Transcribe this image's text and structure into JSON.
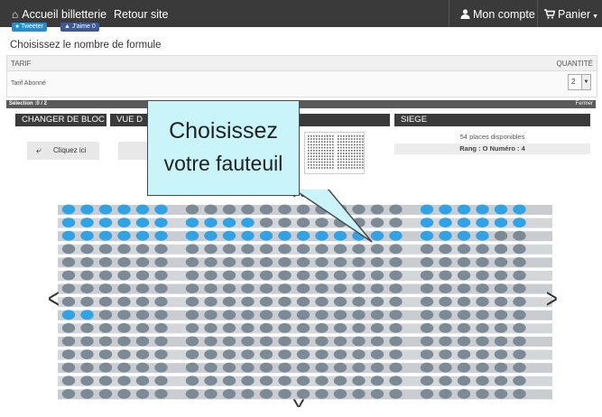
{
  "nav": {
    "home": "Accueil billetterie",
    "back_site": "Retour site",
    "account": "Mon compte",
    "cart": "Panier"
  },
  "social": {
    "tweet": "Tweeter",
    "like": "J'aime 0"
  },
  "section_title": "Choisissez le nombre de formule",
  "tarif_table": {
    "col_tarif": "TARIF",
    "col_quantity": "QUANTITÉ",
    "row_name": "Tarif Abonné",
    "row_quantity": "2"
  },
  "selection_bar": {
    "label": "Sélection :0 / 2",
    "close": "Fermer"
  },
  "seat_panel": {
    "change_block": "CHANGER DE BLOC",
    "view_label": "VUE D",
    "seat_label": "SIEGE",
    "back_button": "Cliquez ici",
    "places_available": "54 places disponibles",
    "row_number": "Rang : O   Numéro : 4"
  },
  "callout": {
    "line1": "Choisissez",
    "line2": "votre fauteuil"
  },
  "seat_map": {
    "rows": [
      "BBBBBB-GGGGGGGGGGGG-BBBBBB",
      "BBBBBB-BBBBGGGGGGGG-BBBBBB",
      "BBBBBB-BBBBBBBBBBBB-BBBBGG",
      "GGGGGG-GGGGGGGGGGGG-GGGGGG",
      "GGGGGG-GGGGGGGGGGGG-GGGGGG",
      "GGGGGG-GGGGGGGGGGGG-GGGGGG",
      "GGGGGG-GGGGGGGGGGGG-GGGGGG",
      "GGGGGG-GGGGGGGGGGGG-GGGGGG",
      "BBGGGG-GGGGGGGGGGGG-GGGGGG",
      "GGGGGG-GGGGGGGGGGGG-GGGGGG",
      "GGGGGG-GGGGGGGGGGGG-GGGGGG",
      "GGGGGG-GGGGGGGGGGGG-GGGGGG",
      "GGGGGG-GGGGGGGGGGGG-GGGGGG",
      "GGGGGG-GGGGGGGGGGGG-GGGGGG",
      "GGGGGG-GGGGGGGGGGGG-GGGGGG"
    ],
    "available_color": "#2fa3e6",
    "taken_color": "#7c8a96"
  },
  "icons": {
    "home": "home-icon",
    "user": "user-icon",
    "cart": "cart-icon",
    "back_arrow": "reply-arrow-icon"
  }
}
